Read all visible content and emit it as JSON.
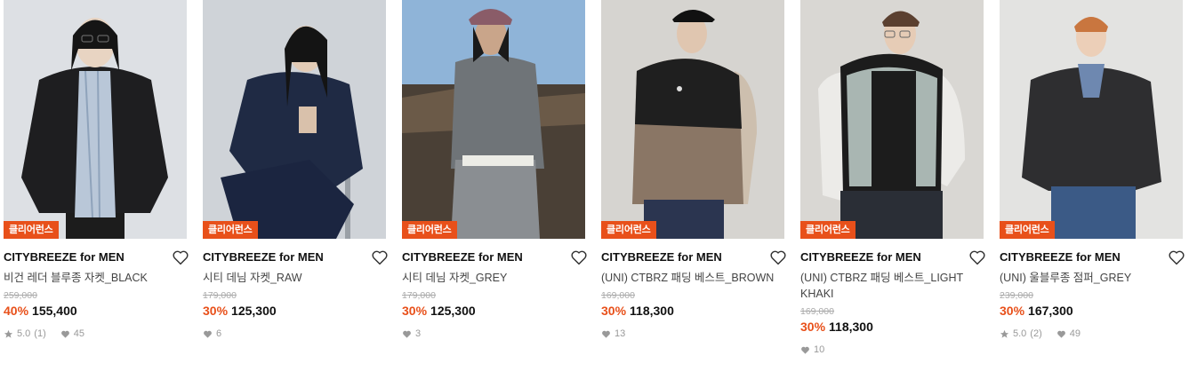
{
  "products": [
    {
      "brand": "CITYBREEZE for MEN",
      "name": "비건 레더 블루종 자켓_BLACK",
      "badge": "클리어런스",
      "original_price": "259,000",
      "discount": "40%",
      "price": "155,400",
      "rating": "5.0",
      "review_count": "(1)",
      "likes": "45"
    },
    {
      "brand": "CITYBREEZE for MEN",
      "name": "시티 데님 자켓_RAW",
      "badge": "클리어런스",
      "original_price": "179,000",
      "discount": "30%",
      "price": "125,300",
      "likes": "6"
    },
    {
      "brand": "CITYBREEZE for MEN",
      "name": "시티 데님 자켓_GREY",
      "badge": "클리어런스",
      "original_price": "179,000",
      "discount": "30%",
      "price": "125,300",
      "likes": "3"
    },
    {
      "brand": "CITYBREEZE for MEN",
      "name": "(UNI) CTBRZ 패딩 베스트_BROWN",
      "badge": "클리어런스",
      "original_price": "169,000",
      "discount": "30%",
      "price": "118,300",
      "likes": "13"
    },
    {
      "brand": "CITYBREEZE for MEN",
      "name": "(UNI) CTBRZ 패딩 베스트_LIGHT KHAKI",
      "badge": "클리어런스",
      "original_price": "169,000",
      "discount": "30%",
      "price": "118,300",
      "likes": "10"
    },
    {
      "brand": "CITYBREEZE for MEN",
      "name": "(UNI) 울블루종 점퍼_GREY",
      "badge": "클리어런스",
      "original_price": "239,000",
      "discount": "30%",
      "price": "167,300",
      "rating": "5.0",
      "review_count": "(2)",
      "likes": "49"
    }
  ],
  "colors": {
    "accent": "#e8501a",
    "text": "#111111",
    "muted": "#999999"
  },
  "icons": {
    "wishlist": "heart-outline-icon",
    "rating": "star-icon",
    "likes": "heart-filled-icon"
  }
}
